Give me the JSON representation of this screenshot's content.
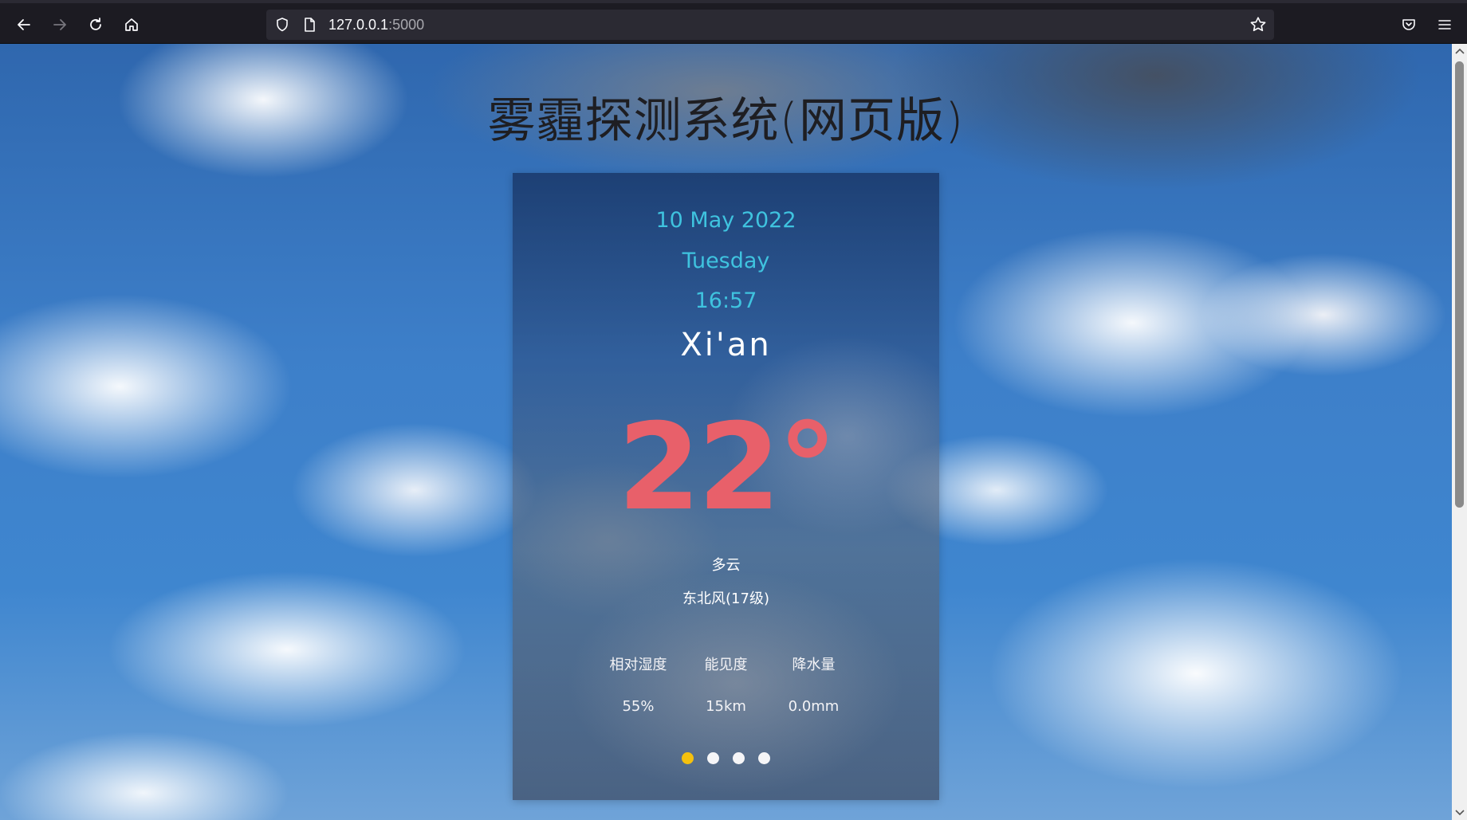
{
  "browser": {
    "url_host": "127.0.0.1",
    "url_port": ":5000",
    "icons": [
      "back-arrow-icon",
      "forward-arrow-icon",
      "reload-icon",
      "home-icon",
      "shield-icon",
      "page-icon",
      "bookmark-star-icon",
      "pocket-icon",
      "menu-icon"
    ]
  },
  "page": {
    "title": "雾霾探测系统(网页版)"
  },
  "weather": {
    "date": "10 May 2022",
    "weekday": "Tuesday",
    "time": "16:57",
    "city": "Xi'an",
    "temperature": "22°",
    "condition": "多云",
    "wind": "东北风(17级)",
    "stats": [
      {
        "label": "相对湿度",
        "value": "55%"
      },
      {
        "label": "能见度",
        "value": "15km"
      },
      {
        "label": "降水量",
        "value": "0.0mm"
      }
    ],
    "carousel": {
      "count": 4,
      "active_index": 0
    }
  },
  "colors": {
    "accent_date": "#3fc3df",
    "temperature": "#e8606a",
    "active_dot": "#f5c10e"
  }
}
